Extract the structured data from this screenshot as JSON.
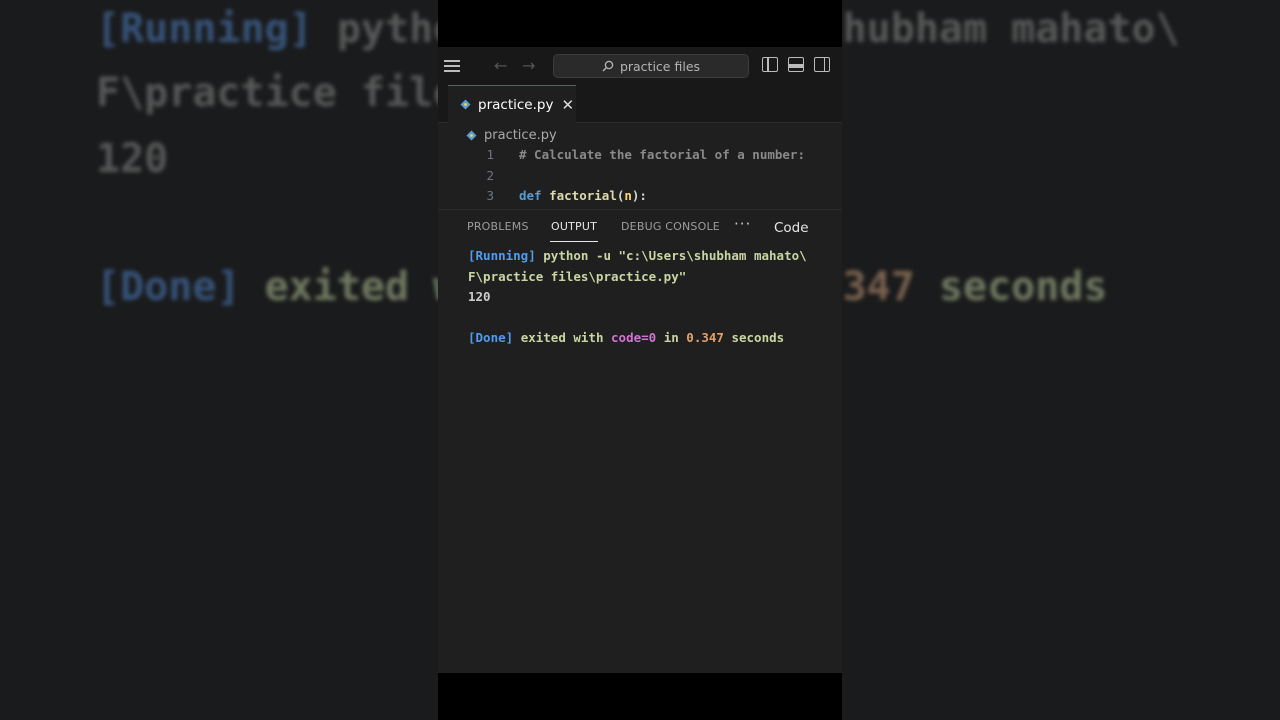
{
  "background_mirror": {
    "line1_running": "[Running]",
    "line1_rest": "python -u \"c:\\Users\\shubham mahato\\",
    "line2": "F\\practice files\\practice.py\"",
    "line3": "120",
    "line4_done": "[Done]",
    "line4_exited": "exited with code=0 in",
    "line4_num": "0.347",
    "line4_seconds": "seconds"
  },
  "titlebar": {
    "menu_icon": "hamburger-menu-icon",
    "back_icon": "←",
    "forward_icon": "→",
    "search_placeholder": "practice files",
    "layout_icons": [
      "toggle-primary-sidebar-icon",
      "toggle-panel-icon",
      "toggle-secondary-sidebar-icon"
    ]
  },
  "tab": {
    "label": "practice.py",
    "close_glyph": "✕"
  },
  "breadcrumb": {
    "file": "practice.py"
  },
  "editor": {
    "lines": [
      {
        "num": "1",
        "comment": "# Calculate the factorial of a number:"
      },
      {
        "num": "2"
      },
      {
        "num": "3",
        "kw": "def",
        "fn": "factorial",
        "open": "(",
        "param": "n",
        "close": "):"
      }
    ]
  },
  "panel": {
    "tabs": [
      "PROBLEMS",
      "OUTPUT",
      "DEBUG CONSOLE"
    ],
    "active_tab": "OUTPUT",
    "more": "···",
    "channel": "Code"
  },
  "output": {
    "running_tag": "[Running]",
    "running_cmd": "python -u \"c:\\Users\\shubham mahato\\",
    "running_cmd_cont": "F\\practice files\\practice.py\"",
    "result": "120",
    "done_tag": "[Done]",
    "exited": "exited with",
    "code": "code=0",
    "in": "in",
    "time": "0.347",
    "seconds": "seconds"
  },
  "colors": {
    "accent": "#0078d4",
    "editor_bg": "#1f1f1f",
    "titlebar_bg": "#181818"
  }
}
